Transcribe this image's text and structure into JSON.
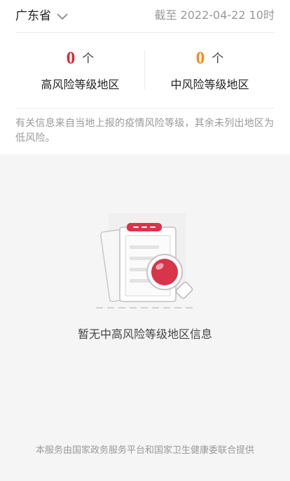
{
  "header": {
    "province": "广东省",
    "deadline": "截至 2022-04-22 10时"
  },
  "stats": {
    "high": {
      "count": "0",
      "unit": "个",
      "label": "高风险等级地区",
      "color": "#e0262e"
    },
    "mid": {
      "count": "0",
      "unit": "个",
      "label": "中风险等级地区",
      "color": "#f5891e"
    }
  },
  "notice": "有关信息来自当地上报的疫情风险等级，其余未列出地区为低风险。",
  "empty_state": {
    "text": "暂无中高风险等级地区信息",
    "icon": "empty-document-search-icon"
  },
  "footer": "本服务由国家政务服务平台和国家卫生健康委联合提供",
  "colors": {
    "accent_red": "#e0262e",
    "accent_orange": "#f5891e",
    "page_bg": "#f5f5f5"
  }
}
